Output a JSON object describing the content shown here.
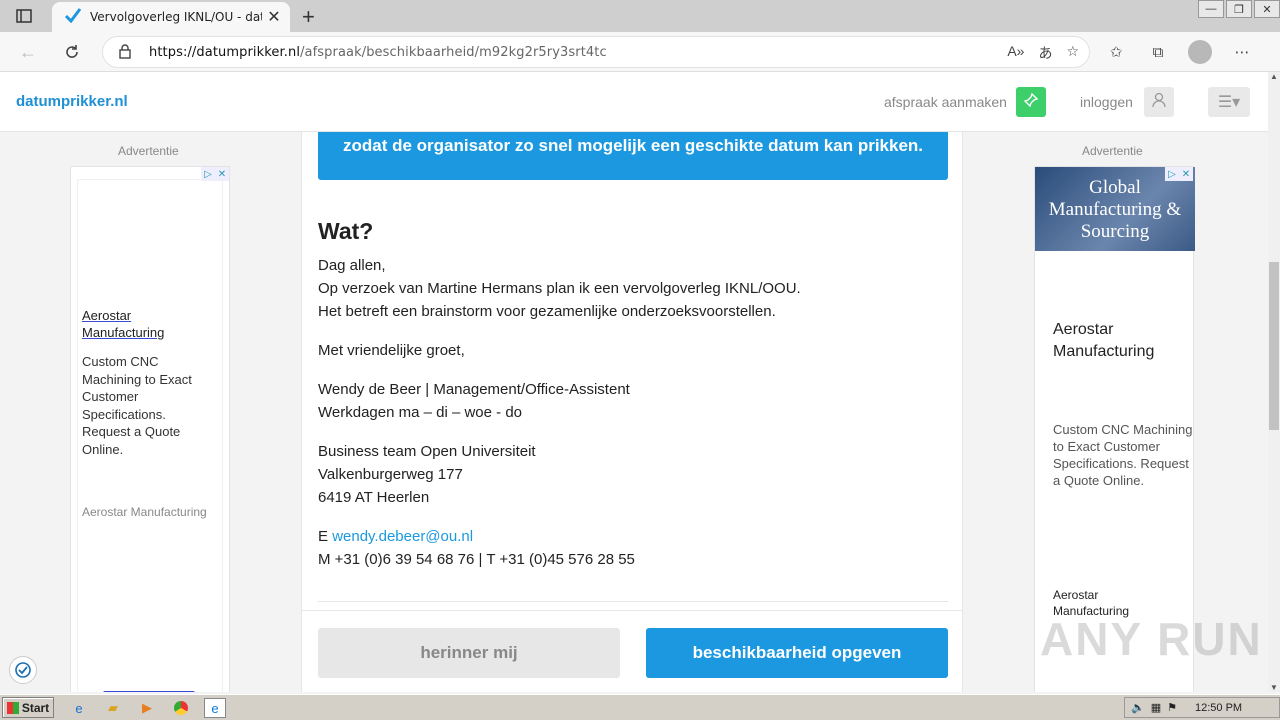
{
  "browser": {
    "tab_title": "Vervolgoverleg IKNL/OU - datumprikker.nl",
    "tab_close": "✕",
    "new_tab": "+",
    "url_domain": "https://datumprikker.nl",
    "url_path": "/afspraak/beschikbaarheid/m92kg2r5ry3srt4tc"
  },
  "header": {
    "brand": "datumprikker.nl",
    "create_link": "afspraak aanmaken",
    "login_link": "inloggen"
  },
  "ads": {
    "left": {
      "label": "Advertentie",
      "title": "Aerostar Manufacturing",
      "body": "Custom CNC Machining to Exact Customer Specifications. Request a Quote Online.",
      "footer": "Aerostar Manufacturing"
    },
    "right": {
      "label": "Advertentie",
      "image_text": "Global Manufacturing & Sourcing",
      "title": "Aerostar Manufacturing",
      "body": "Custom CNC Machining to Exact Customer Specifications. Request a Quote Online.",
      "footer": "Aerostar Manufacturing"
    }
  },
  "main": {
    "banner": "zodat de organisator zo snel mogelijk een geschikte datum kan prikken.",
    "section_title": "Wat?",
    "paragraphs": {
      "p1_l1": "Dag allen,",
      "p1_l2": "Op verzoek van Martine Hermans plan ik een vervolgoverleg IKNL/OOU.",
      "p1_l3": "Het betreft een brainstorm voor gezamenlijke onderzoeksvoorstellen.",
      "p2": "Met vriendelijke groet,",
      "p3_l1": "Wendy de Beer | Management/Office-Assistent",
      "p3_l2": "Werkdagen ma – di – woe - do",
      "p4_l1": "Business team Open Universiteit",
      "p4_l2": "Valkenburgerweg 177",
      "p4_l3": "6419 AT Heerlen",
      "email_prefix": "E ",
      "email": "wendy.debeer@ou.nl",
      "phone": "M +31 (0)6 39 54 68 76 | T +31 (0)45 576 28 55"
    },
    "remind_button": "herinner mij",
    "availability_button": "beschikbaarheid opgeven"
  },
  "taskbar": {
    "start": "Start",
    "clock": "12:50 PM"
  },
  "watermark": "ANY RUN"
}
